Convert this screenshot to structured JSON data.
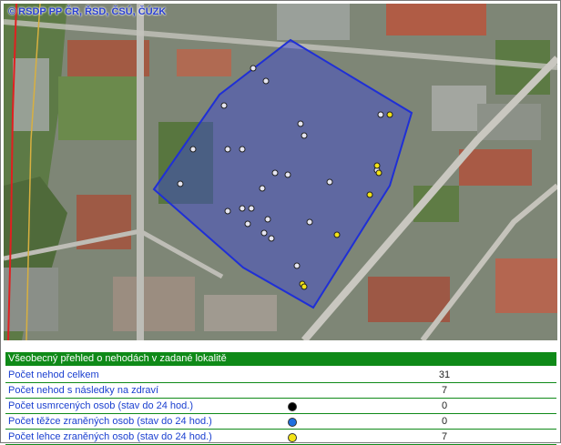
{
  "map": {
    "copyright": "© RSDP PP ČR, ŘSD, ČSÚ, ČÚZK",
    "polygon_color": "#1f2fd6",
    "fill_color": "#3a44d8"
  },
  "summary": {
    "header": "Všeobecný přehled o nehodách v zadané lokalitě",
    "rows": [
      {
        "label": "Počet nehod celkem",
        "value": "31",
        "legend_color": ""
      },
      {
        "label": "Počet nehod s následky na zdraví",
        "value": "7",
        "legend_color": ""
      },
      {
        "label": "Počet usmrcených osob (stav do 24 hod.)",
        "value": "0",
        "legend_color": "#000000"
      },
      {
        "label": "Počet těžce zraněných osob (stav do 24 hod.)",
        "value": "0",
        "legend_color": "#1f6fe0"
      },
      {
        "label": "Počet lehce zraněných osob (stav do 24 hod.)",
        "value": "7",
        "legend_color": "#f3e316"
      }
    ]
  }
}
